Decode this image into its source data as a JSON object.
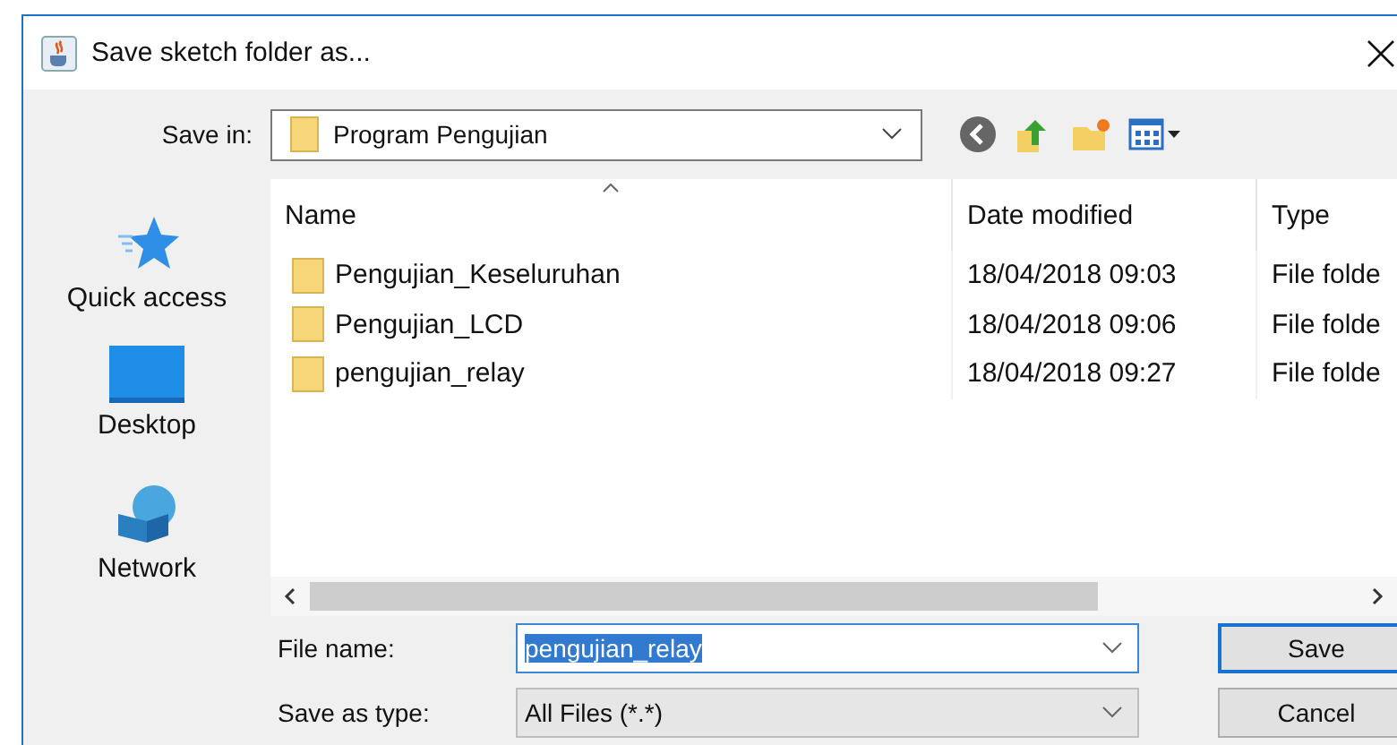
{
  "window": {
    "title": "Save sketch folder as..."
  },
  "save_in": {
    "label": "Save in:",
    "value": "Program Pengujian"
  },
  "places": [
    {
      "label": "Quick access",
      "kind": "star"
    },
    {
      "label": "Desktop",
      "kind": "desktop"
    },
    {
      "label": "Network",
      "kind": "network"
    }
  ],
  "columns": [
    "Name",
    "Date modified",
    "Type"
  ],
  "rows": [
    {
      "name": "Pengujian_Keseluruhan",
      "date": "18/04/2018 09:03",
      "type": "File folde"
    },
    {
      "name": "Pengujian_LCD",
      "date": "18/04/2018 09:06",
      "type": "File folde"
    },
    {
      "name": "pengujian_relay",
      "date": "18/04/2018 09:27",
      "type": "File folde"
    }
  ],
  "file_name": {
    "label": "File name:",
    "value": "pengujian_relay",
    "text_selected": true
  },
  "save_as_type": {
    "label": "Save as type:",
    "value": "All Files (*.*)"
  },
  "buttons": [
    {
      "label": "Save",
      "default": true
    },
    {
      "label": "Cancel",
      "default": false
    }
  ]
}
